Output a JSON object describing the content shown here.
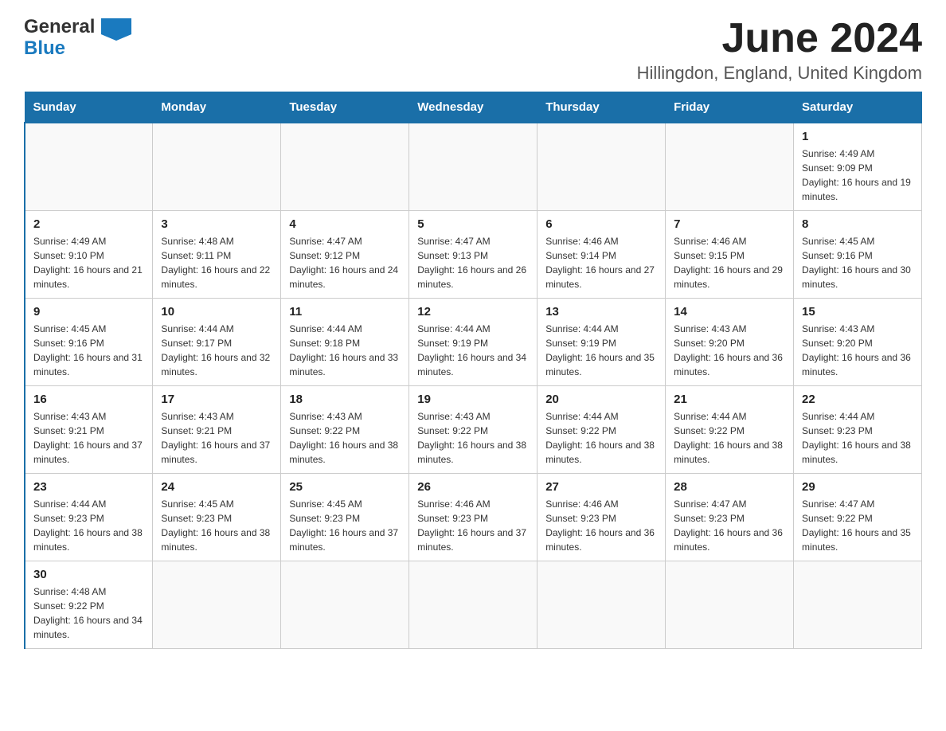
{
  "header": {
    "logo_line1": "General",
    "logo_line2": "Blue",
    "title": "June 2024",
    "subtitle": "Hillingdon, England, United Kingdom"
  },
  "days_of_week": [
    "Sunday",
    "Monday",
    "Tuesday",
    "Wednesday",
    "Thursday",
    "Friday",
    "Saturday"
  ],
  "weeks": [
    [
      {
        "day": "",
        "sunrise": "",
        "sunset": "",
        "daylight": ""
      },
      {
        "day": "",
        "sunrise": "",
        "sunset": "",
        "daylight": ""
      },
      {
        "day": "",
        "sunrise": "",
        "sunset": "",
        "daylight": ""
      },
      {
        "day": "",
        "sunrise": "",
        "sunset": "",
        "daylight": ""
      },
      {
        "day": "",
        "sunrise": "",
        "sunset": "",
        "daylight": ""
      },
      {
        "day": "",
        "sunrise": "",
        "sunset": "",
        "daylight": ""
      },
      {
        "day": "1",
        "sunrise": "Sunrise: 4:49 AM",
        "sunset": "Sunset: 9:09 PM",
        "daylight": "Daylight: 16 hours and 19 minutes."
      }
    ],
    [
      {
        "day": "2",
        "sunrise": "Sunrise: 4:49 AM",
        "sunset": "Sunset: 9:10 PM",
        "daylight": "Daylight: 16 hours and 21 minutes."
      },
      {
        "day": "3",
        "sunrise": "Sunrise: 4:48 AM",
        "sunset": "Sunset: 9:11 PM",
        "daylight": "Daylight: 16 hours and 22 minutes."
      },
      {
        "day": "4",
        "sunrise": "Sunrise: 4:47 AM",
        "sunset": "Sunset: 9:12 PM",
        "daylight": "Daylight: 16 hours and 24 minutes."
      },
      {
        "day": "5",
        "sunrise": "Sunrise: 4:47 AM",
        "sunset": "Sunset: 9:13 PM",
        "daylight": "Daylight: 16 hours and 26 minutes."
      },
      {
        "day": "6",
        "sunrise": "Sunrise: 4:46 AM",
        "sunset": "Sunset: 9:14 PM",
        "daylight": "Daylight: 16 hours and 27 minutes."
      },
      {
        "day": "7",
        "sunrise": "Sunrise: 4:46 AM",
        "sunset": "Sunset: 9:15 PM",
        "daylight": "Daylight: 16 hours and 29 minutes."
      },
      {
        "day": "8",
        "sunrise": "Sunrise: 4:45 AM",
        "sunset": "Sunset: 9:16 PM",
        "daylight": "Daylight: 16 hours and 30 minutes."
      }
    ],
    [
      {
        "day": "9",
        "sunrise": "Sunrise: 4:45 AM",
        "sunset": "Sunset: 9:16 PM",
        "daylight": "Daylight: 16 hours and 31 minutes."
      },
      {
        "day": "10",
        "sunrise": "Sunrise: 4:44 AM",
        "sunset": "Sunset: 9:17 PM",
        "daylight": "Daylight: 16 hours and 32 minutes."
      },
      {
        "day": "11",
        "sunrise": "Sunrise: 4:44 AM",
        "sunset": "Sunset: 9:18 PM",
        "daylight": "Daylight: 16 hours and 33 minutes."
      },
      {
        "day": "12",
        "sunrise": "Sunrise: 4:44 AM",
        "sunset": "Sunset: 9:19 PM",
        "daylight": "Daylight: 16 hours and 34 minutes."
      },
      {
        "day": "13",
        "sunrise": "Sunrise: 4:44 AM",
        "sunset": "Sunset: 9:19 PM",
        "daylight": "Daylight: 16 hours and 35 minutes."
      },
      {
        "day": "14",
        "sunrise": "Sunrise: 4:43 AM",
        "sunset": "Sunset: 9:20 PM",
        "daylight": "Daylight: 16 hours and 36 minutes."
      },
      {
        "day": "15",
        "sunrise": "Sunrise: 4:43 AM",
        "sunset": "Sunset: 9:20 PM",
        "daylight": "Daylight: 16 hours and 36 minutes."
      }
    ],
    [
      {
        "day": "16",
        "sunrise": "Sunrise: 4:43 AM",
        "sunset": "Sunset: 9:21 PM",
        "daylight": "Daylight: 16 hours and 37 minutes."
      },
      {
        "day": "17",
        "sunrise": "Sunrise: 4:43 AM",
        "sunset": "Sunset: 9:21 PM",
        "daylight": "Daylight: 16 hours and 37 minutes."
      },
      {
        "day": "18",
        "sunrise": "Sunrise: 4:43 AM",
        "sunset": "Sunset: 9:22 PM",
        "daylight": "Daylight: 16 hours and 38 minutes."
      },
      {
        "day": "19",
        "sunrise": "Sunrise: 4:43 AM",
        "sunset": "Sunset: 9:22 PM",
        "daylight": "Daylight: 16 hours and 38 minutes."
      },
      {
        "day": "20",
        "sunrise": "Sunrise: 4:44 AM",
        "sunset": "Sunset: 9:22 PM",
        "daylight": "Daylight: 16 hours and 38 minutes."
      },
      {
        "day": "21",
        "sunrise": "Sunrise: 4:44 AM",
        "sunset": "Sunset: 9:22 PM",
        "daylight": "Daylight: 16 hours and 38 minutes."
      },
      {
        "day": "22",
        "sunrise": "Sunrise: 4:44 AM",
        "sunset": "Sunset: 9:23 PM",
        "daylight": "Daylight: 16 hours and 38 minutes."
      }
    ],
    [
      {
        "day": "23",
        "sunrise": "Sunrise: 4:44 AM",
        "sunset": "Sunset: 9:23 PM",
        "daylight": "Daylight: 16 hours and 38 minutes."
      },
      {
        "day": "24",
        "sunrise": "Sunrise: 4:45 AM",
        "sunset": "Sunset: 9:23 PM",
        "daylight": "Daylight: 16 hours and 38 minutes."
      },
      {
        "day": "25",
        "sunrise": "Sunrise: 4:45 AM",
        "sunset": "Sunset: 9:23 PM",
        "daylight": "Daylight: 16 hours and 37 minutes."
      },
      {
        "day": "26",
        "sunrise": "Sunrise: 4:46 AM",
        "sunset": "Sunset: 9:23 PM",
        "daylight": "Daylight: 16 hours and 37 minutes."
      },
      {
        "day": "27",
        "sunrise": "Sunrise: 4:46 AM",
        "sunset": "Sunset: 9:23 PM",
        "daylight": "Daylight: 16 hours and 36 minutes."
      },
      {
        "day": "28",
        "sunrise": "Sunrise: 4:47 AM",
        "sunset": "Sunset: 9:23 PM",
        "daylight": "Daylight: 16 hours and 36 minutes."
      },
      {
        "day": "29",
        "sunrise": "Sunrise: 4:47 AM",
        "sunset": "Sunset: 9:22 PM",
        "daylight": "Daylight: 16 hours and 35 minutes."
      }
    ],
    [
      {
        "day": "30",
        "sunrise": "Sunrise: 4:48 AM",
        "sunset": "Sunset: 9:22 PM",
        "daylight": "Daylight: 16 hours and 34 minutes."
      },
      {
        "day": "",
        "sunrise": "",
        "sunset": "",
        "daylight": ""
      },
      {
        "day": "",
        "sunrise": "",
        "sunset": "",
        "daylight": ""
      },
      {
        "day": "",
        "sunrise": "",
        "sunset": "",
        "daylight": ""
      },
      {
        "day": "",
        "sunrise": "",
        "sunset": "",
        "daylight": ""
      },
      {
        "day": "",
        "sunrise": "",
        "sunset": "",
        "daylight": ""
      },
      {
        "day": "",
        "sunrise": "",
        "sunset": "",
        "daylight": ""
      }
    ]
  ]
}
